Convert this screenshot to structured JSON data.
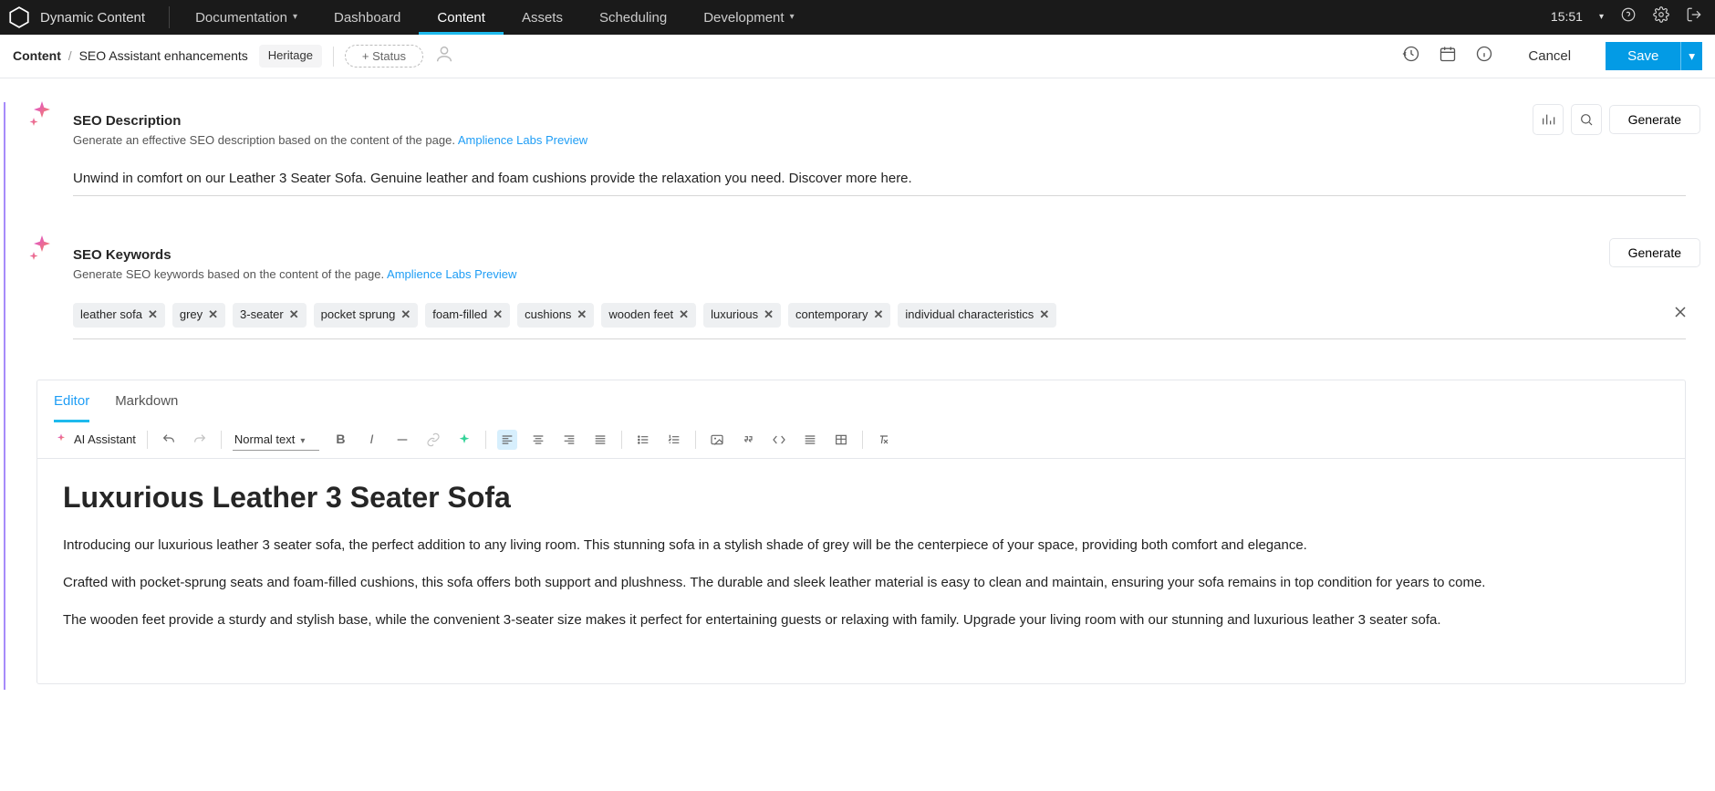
{
  "top": {
    "brand": "Dynamic Content",
    "nav": [
      "Documentation",
      "Dashboard",
      "Content",
      "Assets",
      "Scheduling",
      "Development"
    ],
    "active_index": 2,
    "dropdown_indices": [
      0,
      5
    ],
    "clock": "15:51"
  },
  "sec": {
    "crumb_root": "Content",
    "crumb_page": "SEO Assistant enhancements",
    "heritage_pill": "Heritage",
    "status_btn": "+ Status",
    "cancel": "Cancel",
    "save": "Save"
  },
  "seo_description": {
    "title": "SEO Description",
    "subtitle": "Generate an effective SEO description based on the content of the page.",
    "link_text": "Amplience Labs Preview",
    "value": "Unwind in comfort on our Leather 3 Seater Sofa. Genuine leather and foam cushions provide the relaxation you need. Discover more here.",
    "generate": "Generate"
  },
  "seo_keywords": {
    "title": "SEO Keywords",
    "subtitle": "Generate SEO keywords based on the content of the page.",
    "link_text": "Amplience Labs Preview",
    "generate": "Generate",
    "keywords": [
      "leather sofa",
      "grey",
      "3-seater",
      "pocket sprung",
      "foam-filled",
      "cushions",
      "wooden feet",
      "luxurious",
      "contemporary",
      "individual characteristics"
    ]
  },
  "editor": {
    "tabs": {
      "editor": "Editor",
      "markdown": "Markdown"
    },
    "ai_label": "AI Assistant",
    "format": "Normal text",
    "heading": "Luxurious Leather 3 Seater Sofa",
    "p1": "Introducing our luxurious leather 3 seater sofa, the perfect addition to any living room. This stunning sofa in a stylish shade of grey will be the centerpiece of your space, providing both comfort and elegance.",
    "p2": "Crafted with pocket-sprung seats and foam-filled cushions, this sofa offers both support and plushness. The durable and sleek leather material is easy to clean and maintain, ensuring your sofa remains in top condition for years to come.",
    "p3": "The wooden feet provide a sturdy and stylish base, while the convenient 3-seater size makes it perfect for entertaining guests or relaxing with family. Upgrade your living room with our stunning and luxurious leather 3 seater sofa."
  }
}
